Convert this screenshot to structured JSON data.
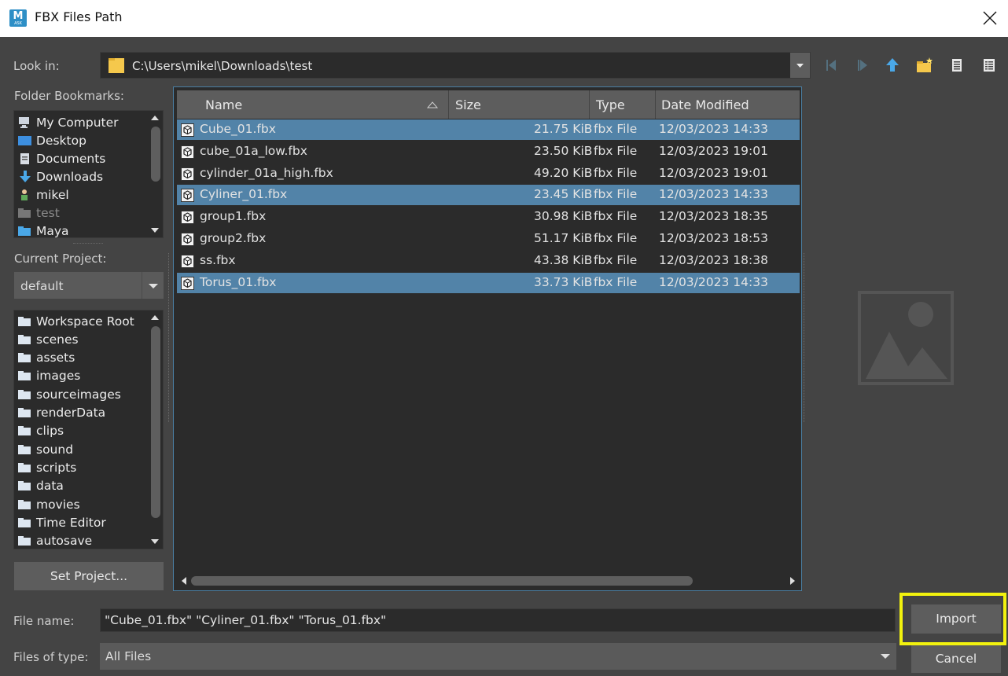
{
  "window": {
    "title": "FBX Files Path",
    "app_icon_letter": "M"
  },
  "look_in": {
    "label": "Look in:",
    "path": "C:\\Users\\mikel\\Downloads\\test"
  },
  "toolbar": {
    "icons": [
      "back-icon",
      "forward-icon",
      "up-folder-icon",
      "new-folder-icon",
      "list-view-icon",
      "detail-view-icon"
    ]
  },
  "bookmarks": {
    "label": "Folder Bookmarks:",
    "items": [
      {
        "label": "My Computer",
        "icon": "computer-icon"
      },
      {
        "label": "Desktop",
        "icon": "desktop-icon"
      },
      {
        "label": "Documents",
        "icon": "documents-icon"
      },
      {
        "label": "Downloads",
        "icon": "downloads-icon"
      },
      {
        "label": "mikel",
        "icon": "user-icon"
      },
      {
        "label": "test",
        "icon": "folder-icon",
        "dim": true
      },
      {
        "label": "Maya",
        "icon": "folder-icon"
      }
    ]
  },
  "project": {
    "label": "Current Project:",
    "value": "default",
    "folders": [
      "Workspace Root",
      "scenes",
      "assets",
      "images",
      "sourceimages",
      "renderData",
      "clips",
      "sound",
      "scripts",
      "data",
      "movies",
      "Time Editor",
      "autosave"
    ],
    "set_button": "Set Project..."
  },
  "files": {
    "columns": [
      "Name",
      "Size",
      "Type",
      "Date Modified"
    ],
    "rows": [
      {
        "name": "Cube_01.fbx",
        "size": "21.75 KiB",
        "type": "fbx File",
        "date": "12/03/2023 14:33",
        "selected": true
      },
      {
        "name": "cube_01a_low.fbx",
        "size": "23.50 KiB",
        "type": "fbx File",
        "date": "12/03/2023 19:01",
        "selected": false
      },
      {
        "name": "cylinder_01a_high.fbx",
        "size": "49.20 KiB",
        "type": "fbx File",
        "date": "12/03/2023 19:01",
        "selected": false
      },
      {
        "name": "Cyliner_01.fbx",
        "size": "23.45 KiB",
        "type": "fbx File",
        "date": "12/03/2023 14:33",
        "selected": true
      },
      {
        "name": "group1.fbx",
        "size": "30.98 KiB",
        "type": "fbx File",
        "date": "12/03/2023 18:35",
        "selected": false
      },
      {
        "name": "group2.fbx",
        "size": "51.17 KiB",
        "type": "fbx File",
        "date": "12/03/2023 18:53",
        "selected": false
      },
      {
        "name": "ss.fbx",
        "size": "43.38 KiB",
        "type": "fbx File",
        "date": "12/03/2023 18:38",
        "selected": false
      },
      {
        "name": "Torus_01.fbx",
        "size": "33.73 KiB",
        "type": "fbx File",
        "date": "12/03/2023 14:33",
        "selected": true
      }
    ]
  },
  "file_name": {
    "label": "File name:",
    "value": "\"Cube_01.fbx\" \"Cyliner_01.fbx\" \"Torus_01.fbx\""
  },
  "file_type": {
    "label": "Files of type:",
    "value": "All Files"
  },
  "buttons": {
    "import": "Import",
    "cancel": "Cancel"
  },
  "colors": {
    "selection": "#5283a8",
    "highlight_box": "#f2f20e",
    "app_icon": "#2e8fc6"
  }
}
